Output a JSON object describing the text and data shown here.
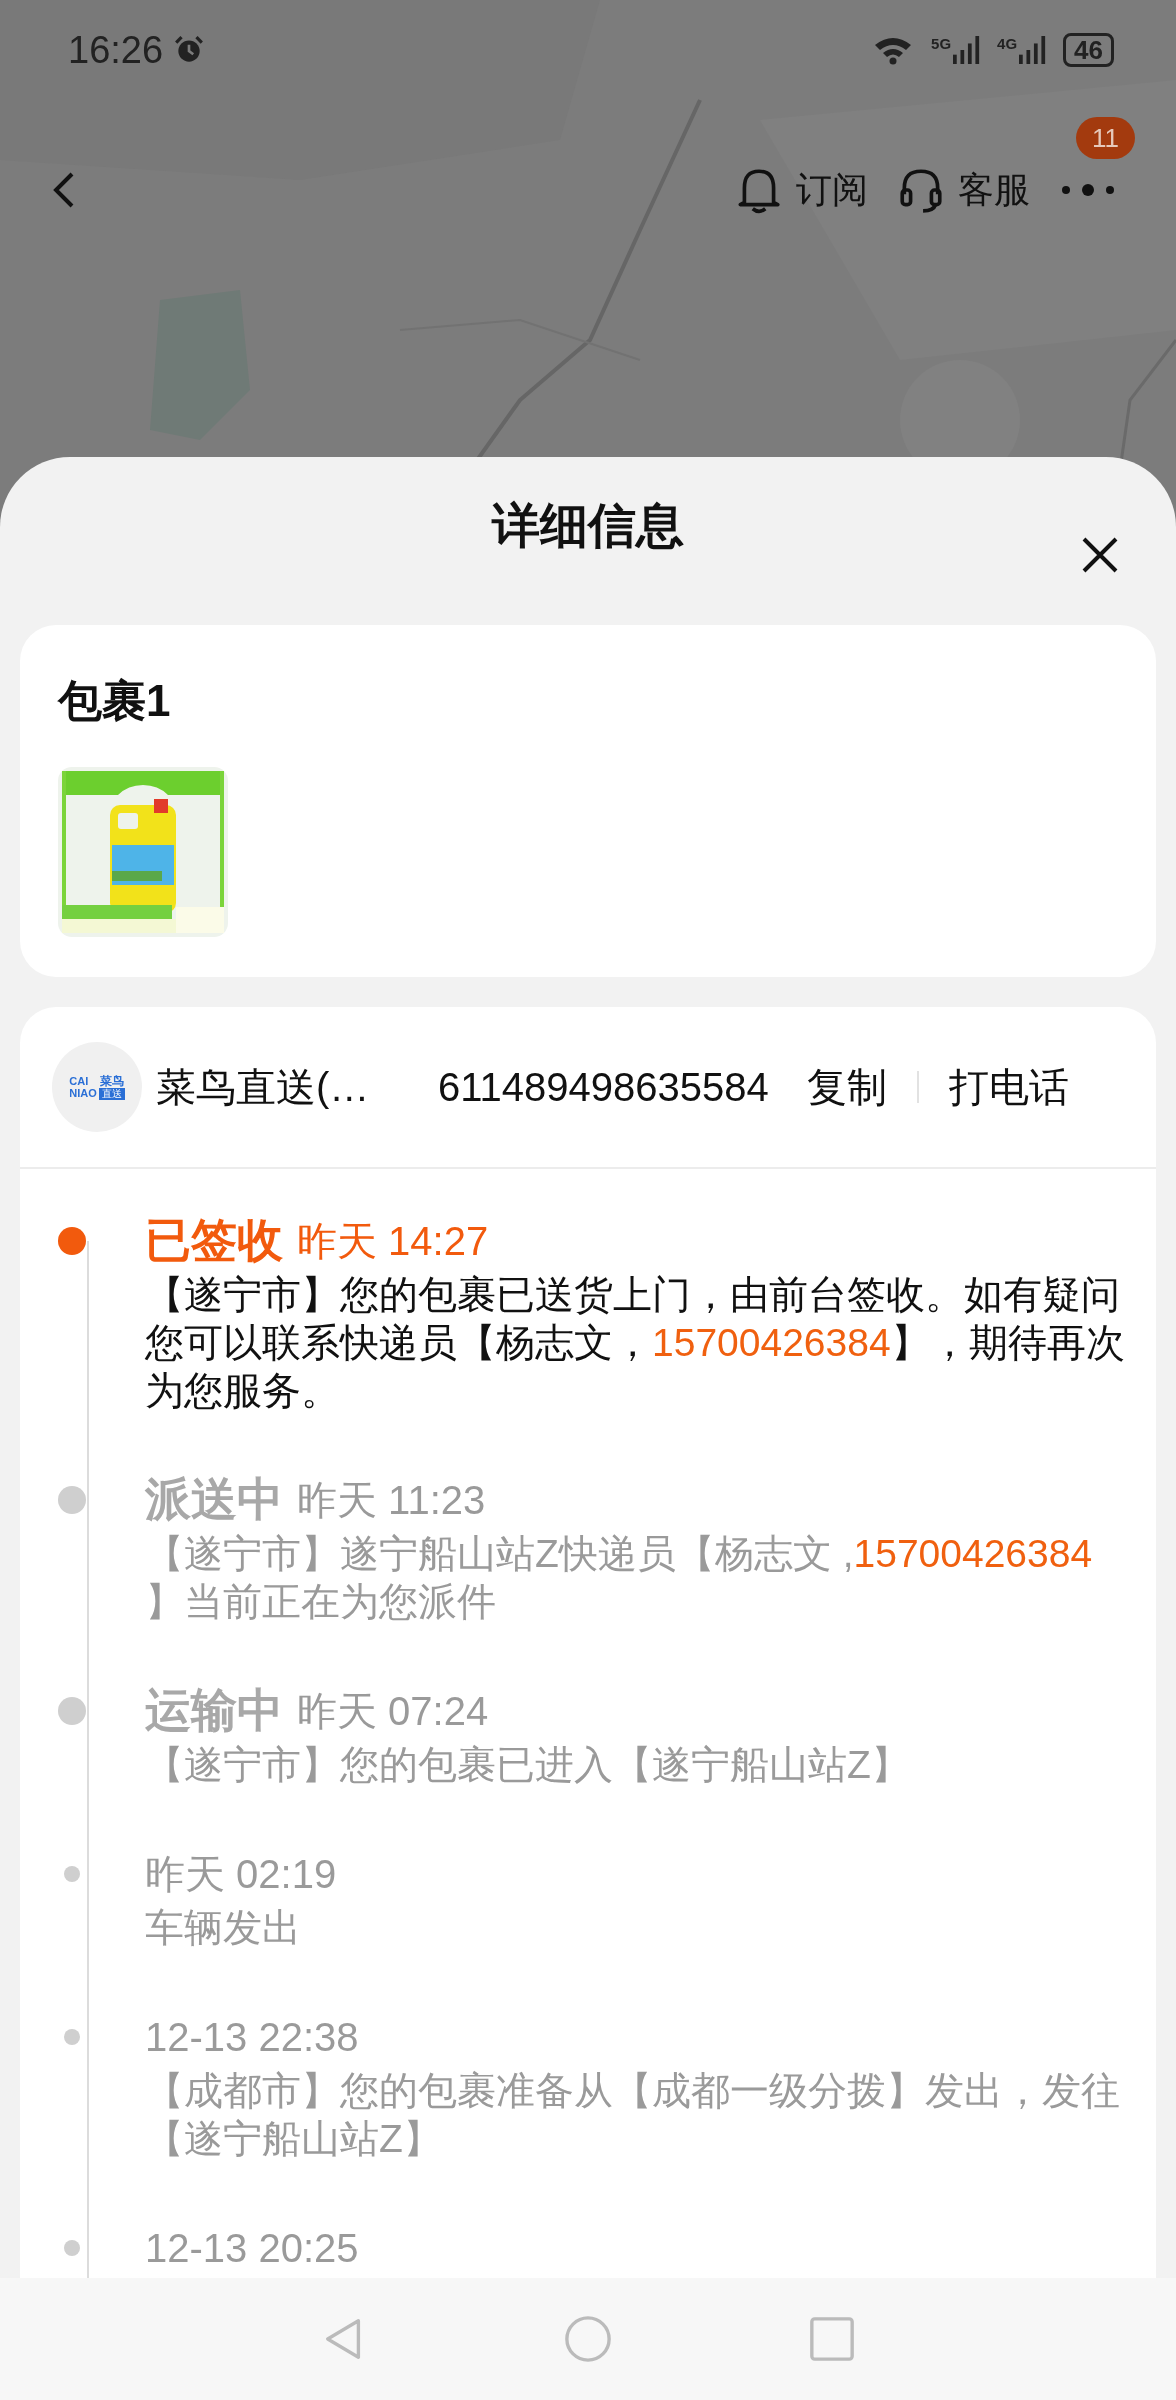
{
  "status_bar": {
    "time": "16:26",
    "network_labels": [
      "5G",
      "4G"
    ],
    "battery": "46"
  },
  "nav": {
    "actions": [
      {
        "kind": "subscribe",
        "label": "订阅"
      },
      {
        "kind": "service",
        "label": "客服"
      }
    ],
    "more_badge": "11"
  },
  "sheet": {
    "title": "详细信息"
  },
  "package": {
    "title": "包裹1"
  },
  "courier": {
    "logo": {
      "lines": [
        "CAI",
        "NIAO"
      ],
      "brand": "菜鸟",
      "tag": "直送"
    },
    "name": "菜鸟直送(…",
    "tracking_number": "611489498635584",
    "copy_label": "复制",
    "call_label": "打电话"
  },
  "timeline": [
    {
      "status": "已签收",
      "time": "昨天 14:27",
      "current": true,
      "body": [
        {
          "kind": "text",
          "text": "【遂宁市】您的包裹已送货上门，由前台签收。如有疑问您可以联系快递员【杨志文，"
        },
        {
          "kind": "phone",
          "text": "15700426384"
        },
        {
          "kind": "text",
          "text": "】，期待再次为您服务。"
        }
      ]
    },
    {
      "status": "派送中",
      "time": "昨天 11:23",
      "current": false,
      "body": [
        {
          "kind": "text",
          "text": "【遂宁市】遂宁船山站Z快递员【杨志文 ,"
        },
        {
          "kind": "phone",
          "text": "15700426384"
        },
        {
          "kind": "text",
          "text": " 】当前正在为您派件"
        }
      ]
    },
    {
      "status": "运输中",
      "time": "昨天 07:24",
      "current": false,
      "body": [
        {
          "kind": "text",
          "text": "【遂宁市】您的包裹已进入【遂宁船山站Z】"
        }
      ]
    },
    {
      "time": "昨天 02:19",
      "current": false,
      "body": [
        {
          "kind": "text",
          "text": "车辆发出"
        }
      ]
    },
    {
      "time": "12-13 22:38",
      "current": false,
      "body": [
        {
          "kind": "text",
          "text": "【成都市】您的包裹准备从【成都一级分拨】发出，发往【遂宁船山站Z】"
        }
      ]
    },
    {
      "time": "12-13 20:25",
      "current": false
    }
  ]
}
